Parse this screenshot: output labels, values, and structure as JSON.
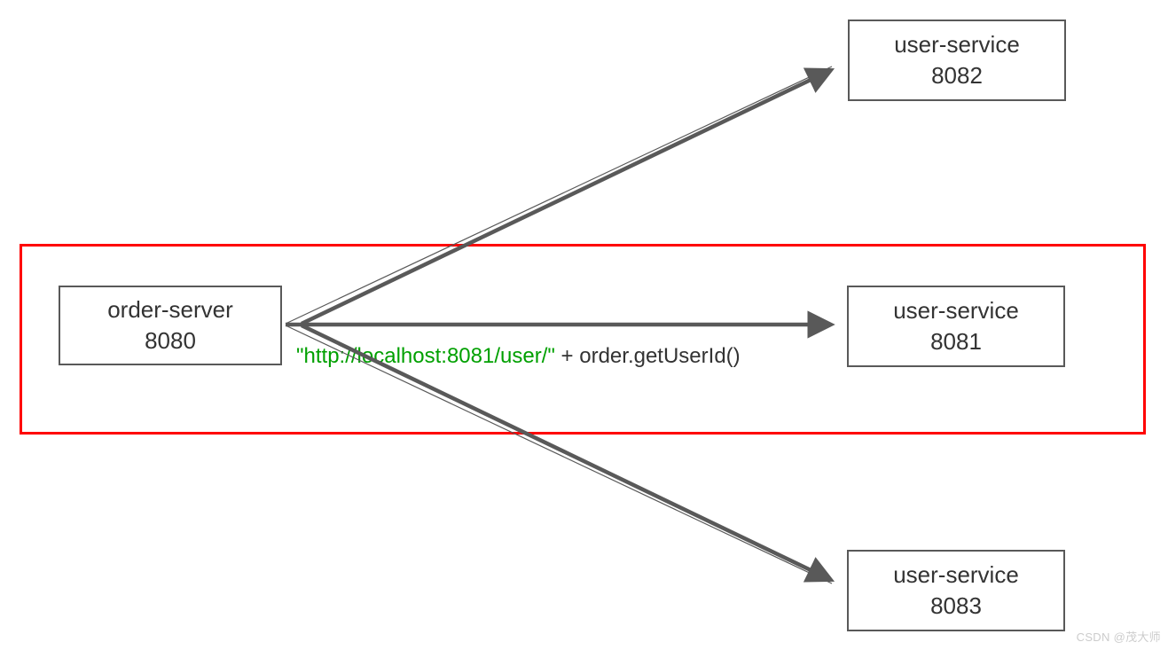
{
  "nodes": {
    "order_server": {
      "name": "order-server",
      "port": "8080"
    },
    "user_service_1": {
      "name": "user-service",
      "port": "8082"
    },
    "user_service_2": {
      "name": "user-service",
      "port": "8081"
    },
    "user_service_3": {
      "name": "user-service",
      "port": "8083"
    }
  },
  "edge_label": {
    "url": "\"http://localhost:8081/user/\"",
    "suffix": " + order.getUserId()"
  },
  "watermark": "CSDN @茂大师"
}
